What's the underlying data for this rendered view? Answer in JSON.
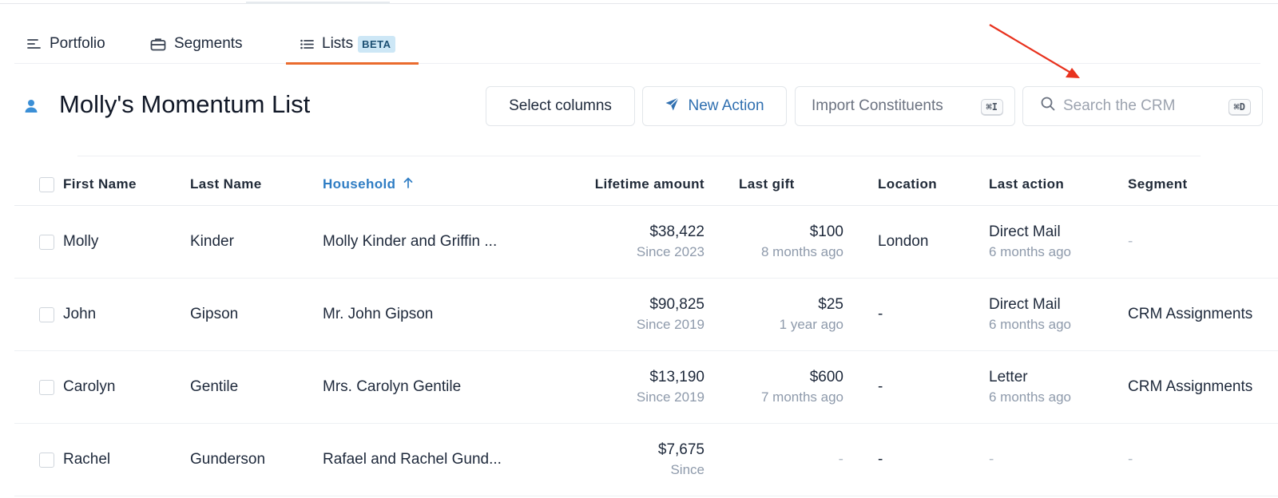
{
  "tabs": [
    {
      "label": "Portfolio",
      "icon": "text-align-icon"
    },
    {
      "label": "Segments",
      "icon": "briefcase-icon"
    },
    {
      "label": "Lists",
      "icon": "list-icon",
      "badge": "BETA",
      "active": true
    }
  ],
  "header": {
    "title": "Molly's Momentum List",
    "select_columns": "Select columns",
    "new_action": "New Action",
    "import": "Import Constituents",
    "import_shortcut": "⌘I",
    "search_placeholder": "Search the CRM",
    "search_shortcut": "⌘D"
  },
  "table": {
    "columns": [
      "First Name",
      "Last Name",
      "Household",
      "Lifetime amount",
      "Last gift",
      "Location",
      "Last action",
      "Segment"
    ],
    "sorted_column": "Household",
    "rows": [
      {
        "first": "Molly",
        "last": "Kinder",
        "household": "Molly Kinder and Griffin ...",
        "lifetime": "$38,422",
        "lifetime_since": "Since 2023",
        "gift": "$100",
        "gift_when": "8 months ago",
        "location": "London",
        "action": "Direct Mail",
        "action_when": "6 months ago",
        "segment": "-"
      },
      {
        "first": "John",
        "last": "Gipson",
        "household": "Mr. John Gipson",
        "lifetime": "$90,825",
        "lifetime_since": "Since 2019",
        "gift": "$25",
        "gift_when": "1 year ago",
        "location": "-",
        "action": "Direct Mail",
        "action_when": "6 months ago",
        "segment": "CRM Assignments"
      },
      {
        "first": "Carolyn",
        "last": "Gentile",
        "household": "Mrs. Carolyn Gentile",
        "lifetime": "$13,190",
        "lifetime_since": "Since 2019",
        "gift": "$600",
        "gift_when": "7 months ago",
        "location": "-",
        "action": "Letter",
        "action_when": "6 months ago",
        "segment": "CRM Assignments"
      },
      {
        "first": "Rachel",
        "last": "Gunderson",
        "household": "Rafael and Rachel Gund...",
        "lifetime": "$7,675",
        "lifetime_since": "Since",
        "gift": "-",
        "gift_when": "",
        "location": "-",
        "action": "-",
        "action_when": "",
        "segment": "-"
      }
    ]
  },
  "colors": {
    "accent_tab": "#ea6b2d",
    "link_blue": "#2f7dc4",
    "arrow": "#e8321e"
  }
}
